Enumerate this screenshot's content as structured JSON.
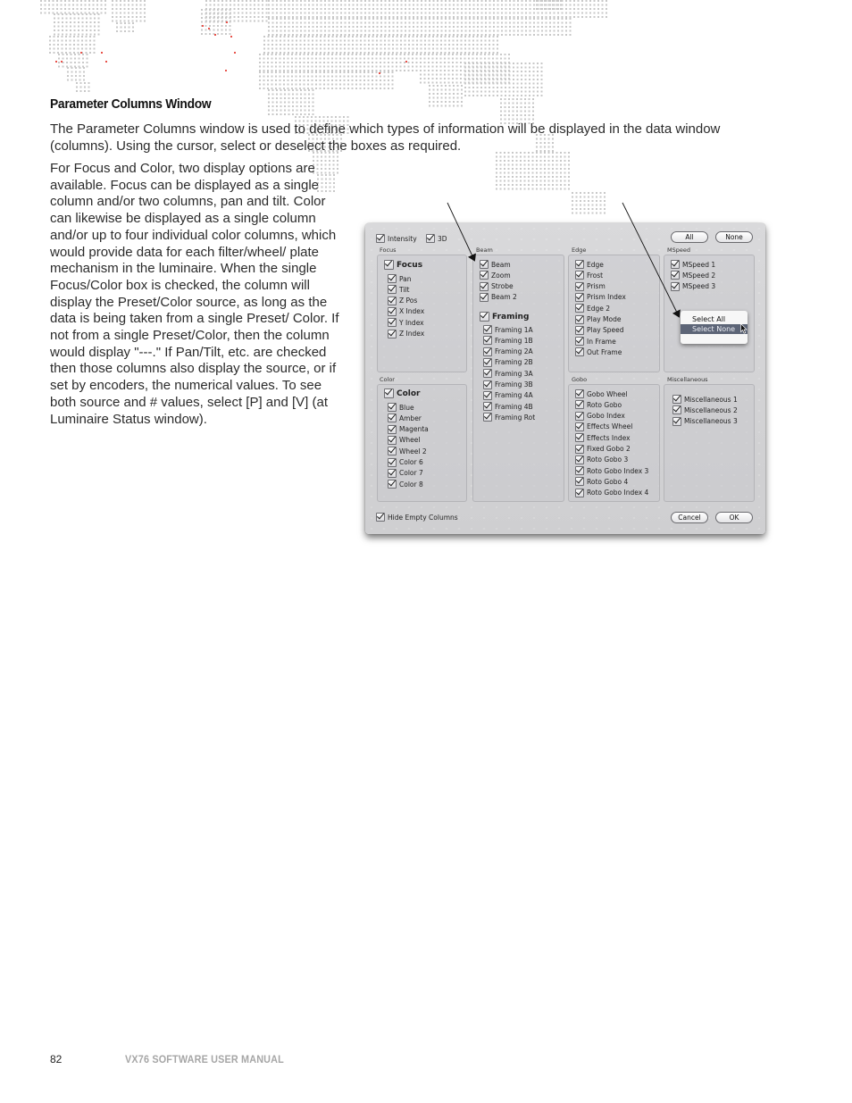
{
  "heading": "Parameter Columns Window",
  "intro": "The Parameter Columns window is used to define which types of information will be displayed in the data window (columns).  Using the cursor, select or deselect the boxes as required.",
  "body": "For Focus and Color, two display options are available. Focus can be displayed as a single column and/or two columns, pan and tilt. Color can likewise be displayed as a single column and/or up to four individual color columns, which would provide data for each filter/wheel/ plate mechanism in the luminaire. When the single Focus/Color box is checked, the column will display the Preset/Color source, as long as the data is being taken from a single Preset/ Color. If not from a single Preset/Color, then the column would display \"---.\" If Pan/Tilt, etc. are checked then those columns also display the source, or if set by encoders, the numerical values. To see both source and # values, select [P] and [V] (at Luminaire Status window).",
  "footer": {
    "page_number": "82",
    "manual_title": "VX76 SOFTWARE USER MANUAL"
  },
  "dialog": {
    "top_checks": [
      {
        "label": "Intensity",
        "checked": true
      },
      {
        "label": "3D",
        "checked": true
      }
    ],
    "top_buttons": {
      "all": "All",
      "none": "None"
    },
    "groups": {
      "focus": {
        "title": "Focus",
        "master": {
          "label": "Focus",
          "checked": true
        },
        "items": [
          "Pan",
          "Tilt",
          "Z Pos",
          "X Index",
          "Y Index",
          "Z Index"
        ]
      },
      "beam": {
        "title": "Beam",
        "items": [
          "Beam",
          "Zoom",
          "Strobe",
          "Beam 2"
        ],
        "framing_master": {
          "label": "Framing",
          "checked": true
        },
        "framing_items": [
          "Framing 1A",
          "Framing 1B",
          "Framing 2A",
          "Framing 2B",
          "Framing 3A",
          "Framing 3B",
          "Framing 4A",
          "Framing 4B",
          "Framing Rot"
        ]
      },
      "edge": {
        "title": "Edge",
        "items": [
          "Edge",
          "Frost",
          "Prism",
          "Prism Index",
          "Edge 2",
          "Play Mode",
          "Play Speed",
          "In Frame",
          "Out Frame"
        ]
      },
      "mspeed": {
        "title": "MSpeed",
        "items": [
          "MSpeed 1",
          "MSpeed 2",
          "MSpeed 3"
        ]
      },
      "color": {
        "title": "Color",
        "master": {
          "label": "Color",
          "checked": true
        },
        "items": [
          "Blue",
          "Amber",
          "Magenta",
          "Wheel",
          "Wheel 2",
          "Color 6",
          "Color 7",
          "Color 8"
        ]
      },
      "gobo": {
        "title": "Gobo",
        "items": [
          "Gobo Wheel",
          "Roto Gobo",
          "Gobo Index",
          "Effects Wheel",
          "Effects Index",
          "Fixed Gobo 2",
          "Roto Gobo 3",
          "Roto Gobo Index 3",
          "Roto Gobo 4",
          "Roto Gobo Index 4"
        ]
      },
      "misc": {
        "title": "Miscellaneous",
        "items": [
          "Miscellaneous 1",
          "Miscellaneous 2",
          "Miscellaneous 3"
        ]
      }
    },
    "context_menu": {
      "items": [
        "Select All",
        "Select None"
      ],
      "highlighted": "Select None"
    },
    "hide_empty": {
      "label": "Hide Empty Columns",
      "checked": true
    },
    "buttons": {
      "cancel": "Cancel",
      "ok": "OK"
    }
  },
  "colors": {
    "map_dot": "#c8c8c8",
    "map_accent": "#e8524a",
    "menu_highlight": "#5d6577",
    "footer_gray": "#a6a6a6"
  }
}
